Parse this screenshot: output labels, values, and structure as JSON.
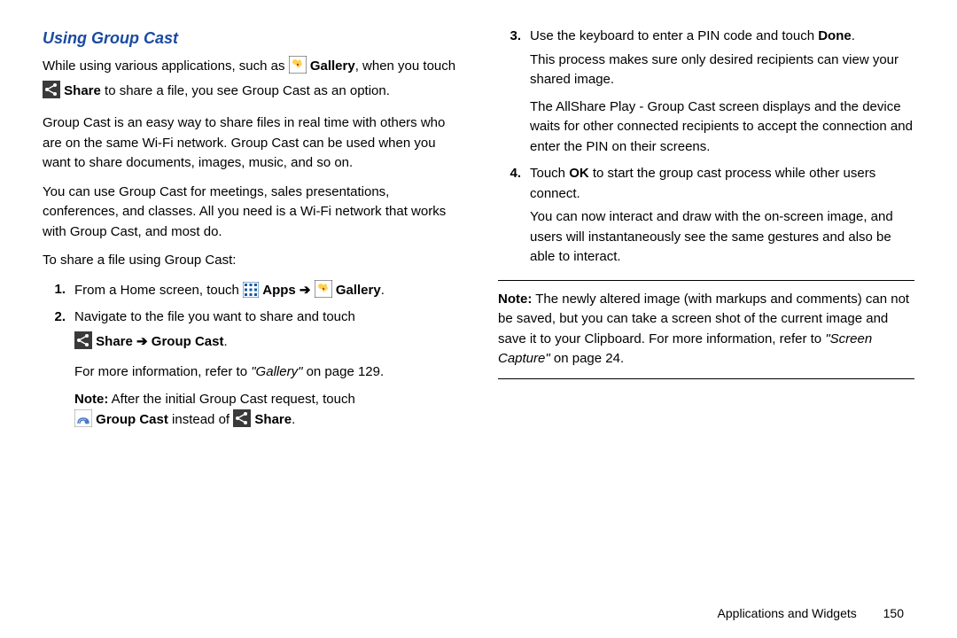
{
  "left": {
    "title": "Using Group Cast",
    "p1_a": "While using various applications, such as ",
    "p1_b": " Gallery",
    "p1_c": ", when you touch ",
    "p1_d": " Share",
    "p1_e": " to share a file, you see Group Cast as an option.",
    "p2": "Group Cast is an easy way to share files in real time with others who are on the same Wi-Fi network. Group Cast can be used when you want to share documents, images, music, and so on.",
    "p3": "You can use Group Cast for meetings, sales presentations, conferences, and classes. All you need is a Wi-Fi network that works with Group Cast, and most do.",
    "p4": "To share a file using Group Cast:",
    "step1_num": "1.",
    "step1_a": "From a Home screen, touch ",
    "step1_b": " Apps",
    "step1_arrow": " ➔ ",
    "step1_c": " Gallery",
    "step1_d": ".",
    "step2_num": "2.",
    "step2_a": "Navigate to the file you want to share and touch",
    "step2_b": " Share",
    "step2_arrow": " ➔ ",
    "step2_c": "Group Cast",
    "step2_d": ".",
    "step2_ref_a": "For more information, refer to ",
    "step2_ref_b": "\"Gallery\"",
    "step2_ref_c": "  on page 129.",
    "note_a": "Note:",
    "note_b": " After the initial Group Cast request, touch",
    "note_c": " Group Cast",
    "note_d": " instead of ",
    "note_e": " Share",
    "note_f": "."
  },
  "right": {
    "step3_num": "3.",
    "step3_a": "Use the keyboard to enter a PIN code and touch ",
    "step3_b": "Done",
    "step3_c": ".",
    "step3_p2": "This process makes sure only desired recipients can view your shared image.",
    "step3_p3": "The AllShare Play - Group Cast screen displays and the device waits for other connected recipients to accept the connection and enter the PIN on their screens.",
    "step4_num": "4.",
    "step4_a": "Touch ",
    "step4_b": "OK",
    "step4_c": " to start the group cast process while other users connect.",
    "step4_p2": "You can now interact and draw with the on-screen image, and users will instantaneously see the same gestures and also be able to interact.",
    "note_a": "Note:",
    "note_b": " The newly altered image (with markups and comments) can not be saved, but you can take a screen shot of the current image and save it to your Clipboard. For more information, refer to ",
    "note_c": "\"Screen Capture\"",
    "note_d": " on page 24."
  },
  "footer": {
    "section": "Applications and Widgets",
    "page": "150"
  }
}
